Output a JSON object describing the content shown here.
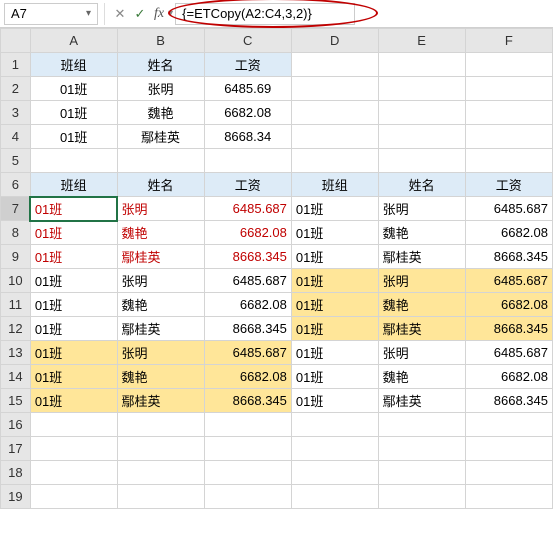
{
  "formula_bar": {
    "cell_ref": "A7",
    "fx_label": "fx",
    "formula": "{=ETCopy(A2:C4,3,2)}"
  },
  "columns": [
    "A",
    "B",
    "C",
    "D",
    "E",
    "F"
  ],
  "row_numbers": [
    "1",
    "2",
    "3",
    "4",
    "5",
    "6",
    "7",
    "8",
    "9",
    "10",
    "11",
    "12",
    "13",
    "14",
    "15",
    "16",
    "17",
    "18",
    "19"
  ],
  "header1": {
    "a": "班组",
    "b": "姓名",
    "c": "工资"
  },
  "top_data": [
    {
      "a": "01班",
      "b": "张明",
      "c": "6485.69"
    },
    {
      "a": "01班",
      "b": "魏艳",
      "c": "6682.08"
    },
    {
      "a": "01班",
      "b": "鄢桂英",
      "c": "8668.34"
    }
  ],
  "header2": {
    "a": "班组",
    "b": "姓名",
    "c": "工资",
    "d": "班组",
    "e": "姓名",
    "f": "工资"
  },
  "grid": [
    {
      "a": "01班",
      "b": "张明",
      "c": "6485.687",
      "d": "01班",
      "e": "张明",
      "f": "6485.687"
    },
    {
      "a": "01班",
      "b": "魏艳",
      "c": "6682.08",
      "d": "01班",
      "e": "魏艳",
      "f": "6682.08"
    },
    {
      "a": "01班",
      "b": "鄢桂英",
      "c": "8668.345",
      "d": "01班",
      "e": "鄢桂英",
      "f": "8668.345"
    },
    {
      "a": "01班",
      "b": "张明",
      "c": "6485.687",
      "d": "01班",
      "e": "张明",
      "f": "6485.687"
    },
    {
      "a": "01班",
      "b": "魏艳",
      "c": "6682.08",
      "d": "01班",
      "e": "魏艳",
      "f": "6682.08"
    },
    {
      "a": "01班",
      "b": "鄢桂英",
      "c": "8668.345",
      "d": "01班",
      "e": "鄢桂英",
      "f": "8668.345"
    },
    {
      "a": "01班",
      "b": "张明",
      "c": "6485.687",
      "d": "01班",
      "e": "张明",
      "f": "6485.687"
    },
    {
      "a": "01班",
      "b": "魏艳",
      "c": "6682.08",
      "d": "01班",
      "e": "魏艳",
      "f": "6682.08"
    },
    {
      "a": "01班",
      "b": "鄢桂英",
      "c": "8668.345",
      "d": "01班",
      "e": "鄢桂英",
      "f": "8668.345"
    }
  ]
}
